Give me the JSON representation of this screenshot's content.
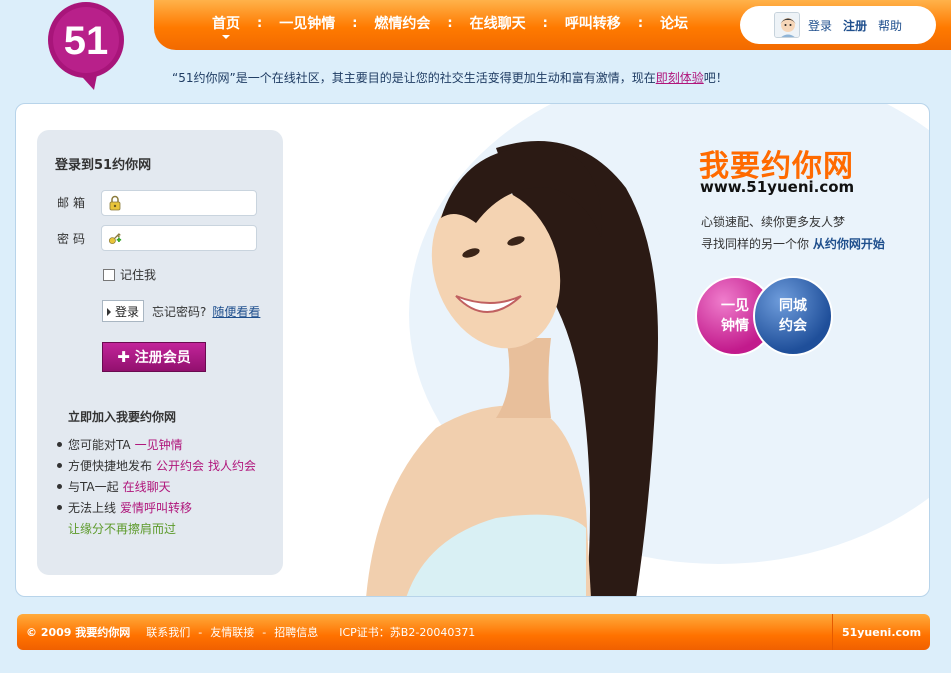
{
  "logo": {
    "text": "51"
  },
  "nav": {
    "items": [
      {
        "label": "首页",
        "active": true
      },
      {
        "label": "一见钟情"
      },
      {
        "label": "燃情约会"
      },
      {
        "label": "在线聊天"
      },
      {
        "label": "呼叫转移"
      },
      {
        "label": "论坛"
      }
    ],
    "separator": ":"
  },
  "user_menu": {
    "login": "登录",
    "register": "注册",
    "help": "帮助"
  },
  "tagline": {
    "prefix": "“51约你网”是一个在线社区，其主要目的是让您的社交生活变得更加生动和富有激情，现在",
    "link": "即刻体验",
    "suffix": "吧！"
  },
  "login": {
    "title": "登录到51约你网",
    "email_label": "邮箱",
    "email_value": "",
    "password_label": "密码",
    "password_value": "",
    "remember_label": "记住我",
    "remember_checked": false,
    "submit_label": "登录",
    "forgot_label": "忘记密码?",
    "browse_label": "随便看看",
    "register_label": "注册会员",
    "join_title": "立即加入我要约你网",
    "features": [
      {
        "text": "您可能对TA",
        "links": [
          "一见钟情"
        ]
      },
      {
        "text": "方便快捷地发布",
        "links": [
          "公开约会",
          "找人约会"
        ]
      },
      {
        "text": "与TA一起",
        "links": [
          "在线聊天"
        ]
      },
      {
        "text": "无法上线",
        "links": [
          "爱情呼叫转移"
        ]
      }
    ],
    "feature_footer": "让缘分不再擦肩而过"
  },
  "hero": {
    "brand_title": "我要约你网",
    "brand_url": "www.51yueni.com",
    "slogan_line1": "心锁速配、续你更多友人梦",
    "slogan_line2_prefix": "寻找同样的另一个你",
    "slogan_line2_strong": "从约你网开始",
    "bubble_pink": [
      "一见",
      "钟情"
    ],
    "bubble_blue": [
      "同城",
      "约会"
    ]
  },
  "footer": {
    "copyright": "© 2009 我要约你网",
    "links": [
      "联系我们",
      "友情联接",
      "招聘信息"
    ],
    "separator": "-",
    "icp": "ICP证书：苏B2-20040371",
    "site": "51yueni.com"
  },
  "colors": {
    "accent_orange": "#ff7a00",
    "brand_magenta": "#b0157b",
    "brand_blue": "#1f4f8d",
    "page_bg": "#dceefa"
  },
  "icons": {
    "logo": "speech-bubble-51-logo",
    "avatar": "user-avatar",
    "email": "lock-icon",
    "password": "key-icon",
    "register": "plus-icon",
    "submit": "arrow-right-icon"
  }
}
